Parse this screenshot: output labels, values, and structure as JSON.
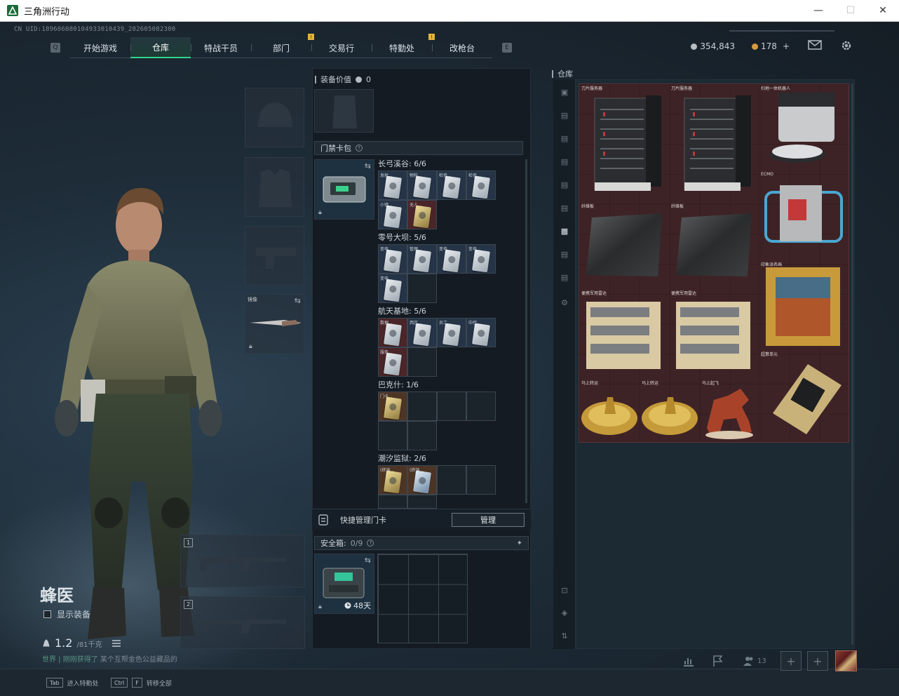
{
  "window": {
    "title": "三角洲行动",
    "minimize": "—",
    "maximize": "☐",
    "close": "✕"
  },
  "uid": "CN UID:18960608010493301043​9_202605082300",
  "nav": {
    "left_key": "Q",
    "right_key": "E",
    "tabs": [
      {
        "label": "开始游戏"
      },
      {
        "label": "仓库"
      },
      {
        "label": "特战干员"
      },
      {
        "label": "部门",
        "alert": "!"
      },
      {
        "label": "交易行"
      },
      {
        "label": "特勤处",
        "alert": "!"
      },
      {
        "label": "改枪台"
      }
    ]
  },
  "currency": {
    "silver": "354,843",
    "gold": "178",
    "gold_add": "+"
  },
  "character": {
    "name": "蜂医",
    "show_equipment": "显示装备",
    "weight": "1.2",
    "weight_max": "/81千克",
    "message_highlight": "世界 | 刚刚获得了 ",
    "message_rest": "某个互帮金色公益藏品的"
  },
  "slots": {
    "melee_label": "镜像",
    "weapon1_num": "1",
    "weapon2_num": "2"
  },
  "equipment_value": {
    "title": "装备价值",
    "value": "0"
  },
  "keybag": {
    "title": "门禁卡包",
    "help": "?",
    "groups": [
      {
        "label": "长弓溪谷: 6/6",
        "cells": [
          "发射...",
          "物料...",
          "检查...",
          "检查...",
          "小镇...",
          "无人..."
        ]
      },
      {
        "label": "零号大坝: 5/6",
        "cells": [
          "变电...",
          "管理...",
          "变电...",
          "变电...",
          "变电..."
        ]
      },
      {
        "label": "航天基地: 5/6",
        "cells": [
          "数据...",
          "西区...",
          "员工...",
          "中控...",
          "服务..."
        ]
      },
      {
        "label": "巴克什: 1/6",
        "cells": [
          "门卡..."
        ]
      },
      {
        "label": "潮汐监狱: 2/6",
        "cells": [
          "(终端...",
          "(终端..."
        ]
      }
    ]
  },
  "manage": {
    "label": "快捷管理门卡",
    "button": "管理"
  },
  "safebox": {
    "title": "安全箱:",
    "count": "0/9",
    "help": "?",
    "pin": "✦",
    "days": "48天"
  },
  "warehouse": {
    "title": "仓库",
    "items": [
      {
        "name": "刀片服务器"
      },
      {
        "name": "刀片服务器"
      },
      {
        "name": "扫地一体机器人"
      },
      {
        "name": "ECMO"
      },
      {
        "name": "纤维板"
      },
      {
        "name": "纤维板"
      },
      {
        "name": "印象派名画"
      },
      {
        "name": "便携军用雷达"
      },
      {
        "name": "便携军用雷达"
      },
      {
        "name": "超算单元"
      },
      {
        "name": "马上转运"
      },
      {
        "name": "马上转运"
      },
      {
        "name": "马上起飞"
      }
    ]
  },
  "bottom": {
    "hint1_key": "Tab",
    "hint1_text": "进入特勤处",
    "hint2_key1": "Ctrl",
    "hint2_key2": "F",
    "hint2_text": "转移全部",
    "friends_count": "13",
    "plus": "+"
  }
}
